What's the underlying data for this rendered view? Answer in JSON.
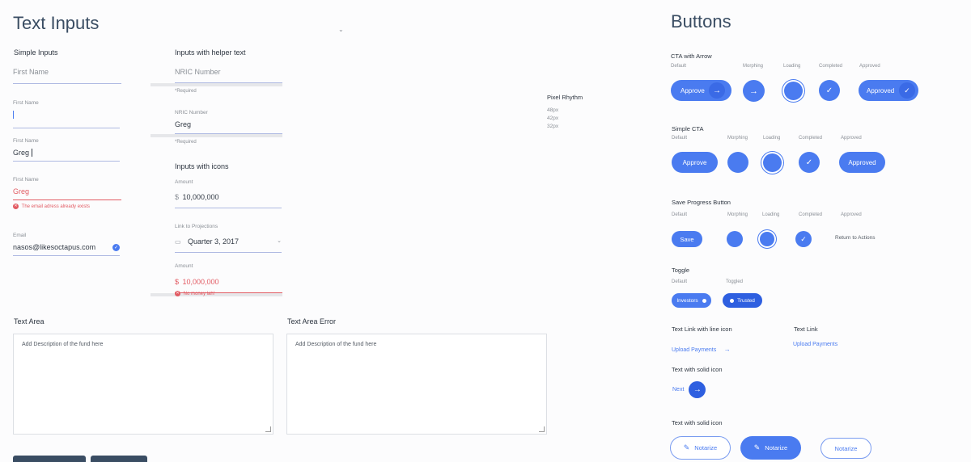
{
  "text_inputs": {
    "title": "Text Inputs",
    "simple": {
      "heading": "Simple Inputs",
      "placeholder": "First Name",
      "label": "First Name",
      "value": "Greg",
      "error_text": "The email adress already exists",
      "email_label": "Email",
      "email_value": "nasos@likesoctapus.com"
    },
    "helper": {
      "heading": "Inputs with helper text",
      "placeholder": "NRIC Number",
      "label": "NRIC Number",
      "value": "Greg",
      "helper": "*Required"
    },
    "icons": {
      "heading": "Inputs with icons",
      "amount_label": "Amount",
      "amount_value": "10,000,000",
      "currency": "$",
      "link_label": "Link to Projections",
      "link_value": "Quarter 3, 2017",
      "error_text": "No money lah!"
    },
    "pixel_rhythm": {
      "heading": "Pixel Rhythm",
      "values": [
        "48px",
        "42px",
        "32px"
      ]
    },
    "textarea": {
      "heading": "Text Area",
      "placeholder": "Add Description of the fund here"
    },
    "textarea_error": {
      "heading": "Text Area Error",
      "placeholder": "Add Description of the fund here"
    }
  },
  "buttons": {
    "title": "Buttons",
    "states": {
      "default": "Default",
      "morphing": "Morphing",
      "loading": "Loading",
      "completed": "Completed",
      "approved": "Approved"
    },
    "cta_arrow": {
      "heading": "CTA with Arrow",
      "approve": "Approve",
      "approved": "Approved"
    },
    "simple_cta": {
      "heading": "Simple CTA",
      "approve": "Approve",
      "approved": "Approved"
    },
    "save_progress": {
      "heading": "Save Progress Button",
      "save": "Save",
      "return": "Return to Actions"
    },
    "toggle": {
      "heading": "Toggle",
      "default": "Default",
      "toggled": "Toggled",
      "investors": "Investors",
      "trusted": "Trusted"
    },
    "text_link_icon": {
      "heading": "Text Link with line icon",
      "label": "Upload Payments"
    },
    "text_link": {
      "heading": "Text Link",
      "label": "Upload Payments"
    },
    "solid_icon": {
      "heading": "Text with solid icon",
      "label": "Next"
    },
    "solid_icon2": {
      "heading": "Text with solid icon",
      "notarize": "Notarize"
    }
  },
  "colors": {
    "accent": "#4a7bf0",
    "error": "#e25b63",
    "heading": "#3a4d63"
  }
}
